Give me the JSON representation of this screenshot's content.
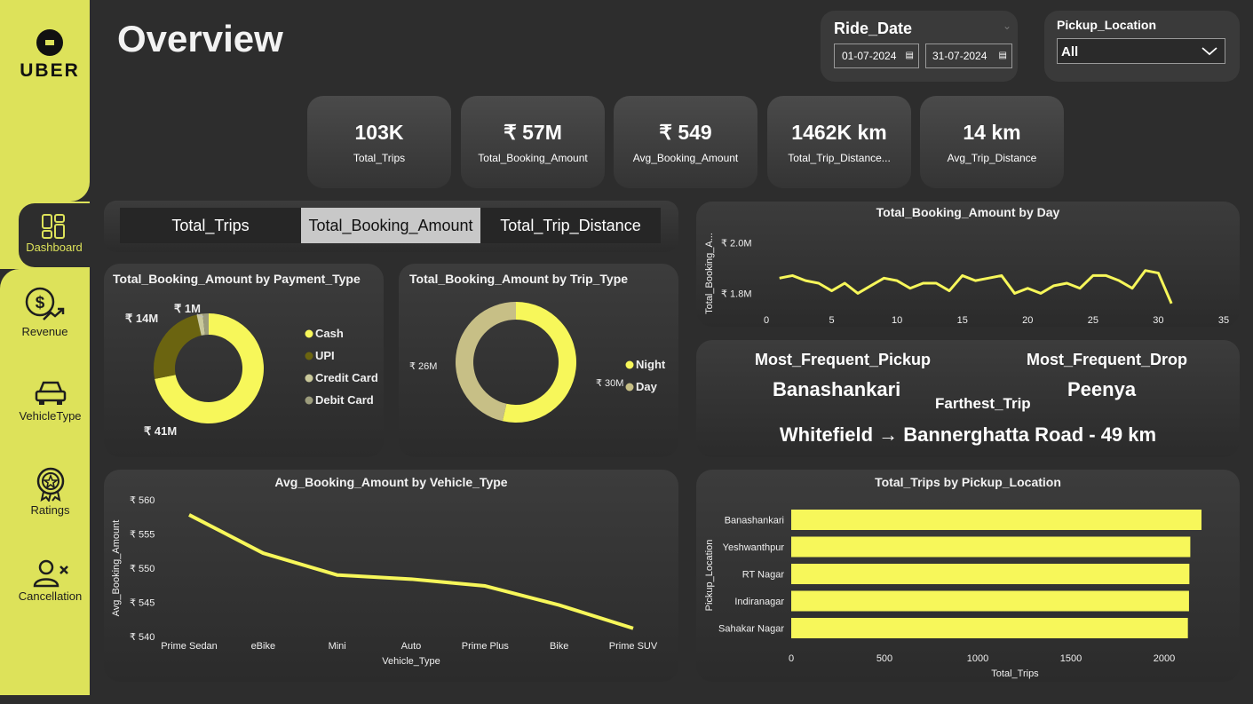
{
  "brand": {
    "logo_text": "UBER"
  },
  "page": {
    "title": "Overview"
  },
  "filters": {
    "ride_date": {
      "label": "Ride_Date",
      "start": "01-07-2024",
      "end": "31-07-2024"
    },
    "pickup_location": {
      "label": "Pickup_Location",
      "value": "All"
    }
  },
  "nav": [
    {
      "label": "Dashboard",
      "icon": "dashboard-icon"
    },
    {
      "label": "Revenue",
      "icon": "revenue-icon"
    },
    {
      "label": "VehicleType",
      "icon": "car-icon"
    },
    {
      "label": "Ratings",
      "icon": "award-icon"
    },
    {
      "label": "Cancellation",
      "icon": "user-cancel-icon"
    }
  ],
  "kpis": [
    {
      "value": "103K",
      "label": "Total_Trips"
    },
    {
      "value": "₹ 57M",
      "label": "Total_Booking_Amount"
    },
    {
      "value": "₹ 549",
      "label": "Avg_Booking_Amount"
    },
    {
      "value": "1462K km",
      "label": "Total_Trip_Distance..."
    },
    {
      "value": "14 km",
      "label": "Avg_Trip_Distance"
    }
  ],
  "tabs": [
    {
      "label": "Total_Trips",
      "selected": false
    },
    {
      "label": "Total_Booking_Amount",
      "selected": true
    },
    {
      "label": "Total_Trip_Distance",
      "selected": false
    }
  ],
  "colors": {
    "accent": "#f7f75a",
    "sidebar": "#dde25a",
    "dark_olive": "#6b6410",
    "light_olive": "#c9c89a",
    "tan": "#c7bf86"
  },
  "info": {
    "pickup_label": "Most_Frequent_Pickup",
    "pickup_value": "Banashankari",
    "drop_label": "Most_Frequent_Drop",
    "drop_value": "Peenya",
    "farthest_label": "Farthest_Trip",
    "farthest_value": "Whitefield → Bannerghatta Road - 49 km"
  },
  "chart_data": [
    {
      "type": "pie",
      "title": "Total_Booking_Amount by Payment_Type",
      "labels": [
        "Cash",
        "UPI",
        "Credit Card",
        "Debit Card"
      ],
      "values": [
        41,
        14,
        1,
        1
      ],
      "data_labels": [
        "₹ 41M",
        "₹ 14M",
        "₹ 1M",
        ""
      ],
      "colors": [
        "#f7f75a",
        "#6b6410",
        "#c9c89a",
        "#9c9c7c"
      ],
      "legend": "right"
    },
    {
      "type": "pie",
      "title": "Total_Booking_Amount by Trip_Type",
      "labels": [
        "Night",
        "Day"
      ],
      "values": [
        30,
        26
      ],
      "data_labels": [
        "₹ 30M",
        "₹ 26M"
      ],
      "colors": [
        "#f7f75a",
        "#c7bf86"
      ],
      "legend": "right"
    },
    {
      "type": "line",
      "title": "Total_Booking_Amount by Day",
      "x": [
        1,
        2,
        3,
        4,
        5,
        6,
        7,
        8,
        9,
        10,
        11,
        12,
        13,
        14,
        15,
        16,
        17,
        18,
        19,
        20,
        21,
        22,
        23,
        24,
        25,
        26,
        27,
        28,
        29,
        30,
        31
      ],
      "series": [
        {
          "values": [
            1.86,
            1.87,
            1.85,
            1.84,
            1.81,
            1.84,
            1.8,
            1.83,
            1.86,
            1.85,
            1.82,
            1.84,
            1.84,
            1.81,
            1.87,
            1.85,
            1.86,
            1.87,
            1.8,
            1.82,
            1.8,
            1.83,
            1.84,
            1.82,
            1.87,
            1.87,
            1.85,
            1.82,
            1.89,
            1.88,
            1.76
          ]
        }
      ],
      "xlabel": "",
      "ylabel": "Total_Booking_A...",
      "xlim": [
        0,
        35
      ],
      "ylim": [
        1.7,
        2.05
      ],
      "xticks": [
        "0",
        "5",
        "10",
        "15",
        "20",
        "25",
        "30",
        "35"
      ],
      "yticks": [
        {
          "v": 2.0,
          "label": "₹ 2.0M"
        },
        {
          "v": 1.8,
          "label": "₹ 1.8M"
        }
      ]
    },
    {
      "type": "line",
      "title": "Avg_Booking_Amount by Vehicle_Type",
      "categories": [
        "Prime Sedan",
        "eBike",
        "Mini",
        "Auto",
        "Prime Plus",
        "Bike",
        "Prime SUV"
      ],
      "series": [
        {
          "values": [
            557.8,
            552.2,
            549.0,
            548.4,
            547.4,
            544.6,
            541.2
          ]
        }
      ],
      "xlabel": "Vehicle_Type",
      "ylabel": "Avg_Booking_Amount",
      "ylim": [
        540,
        560
      ],
      "yticks": [
        {
          "v": 560,
          "label": "₹ 560"
        },
        {
          "v": 555,
          "label": "₹ 555"
        },
        {
          "v": 550,
          "label": "₹ 550"
        },
        {
          "v": 545,
          "label": "₹ 545"
        },
        {
          "v": 540,
          "label": "₹ 540"
        }
      ]
    },
    {
      "type": "bar",
      "title": "Total_Trips by Pickup_Location",
      "categories": [
        "Banashankari",
        "Yeshwanthpur",
        "RT Nagar",
        "Indiranagar",
        "Sahakar Nagar"
      ],
      "values": [
        2200,
        2140,
        2135,
        2133,
        2127
      ],
      "xlabel": "Total_Trips",
      "ylabel": "Pickup_Location",
      "xlim": [
        0,
        2200
      ],
      "xticks": [
        "0",
        "500",
        "1000",
        "1500",
        "2000"
      ]
    }
  ]
}
